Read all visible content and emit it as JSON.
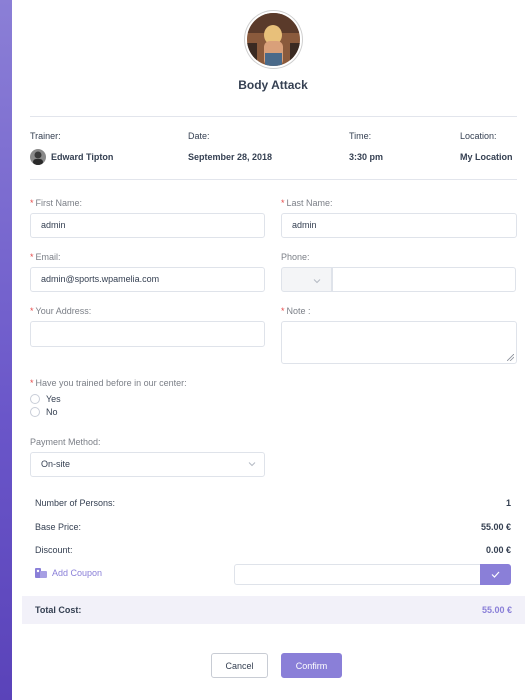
{
  "colors": {
    "accent": "#8a7fd8",
    "required": "#e64b4b",
    "text": "#354052",
    "muted": "#7b7f87"
  },
  "service": {
    "title": "Body Attack"
  },
  "info": {
    "trainer_label": "Trainer:",
    "trainer_value": "Edward Tipton",
    "date_label": "Date:",
    "date_value": "September 28, 2018",
    "time_label": "Time:",
    "time_value": "3:30 pm",
    "location_label": "Location:",
    "location_value": "My Location"
  },
  "form": {
    "required_mark": "*",
    "first_name_label": "First Name:",
    "first_name_value": "admin",
    "last_name_label": "Last Name:",
    "last_name_value": "admin",
    "email_label": "Email:",
    "email_value": "admin@sports.wpamelia.com",
    "phone_label": "Phone:",
    "phone_value": "",
    "address_label": "Your Address:",
    "address_value": "",
    "note_label": "Note :",
    "trained_question": "Have you trained before in our center:",
    "trained_options": [
      "Yes",
      "No"
    ],
    "payment_label": "Payment Method:",
    "payment_value": "On-site"
  },
  "summary": {
    "persons_label": "Number of Persons:",
    "persons_value": "1",
    "base_price_label": "Base Price:",
    "base_price_value": "55.00 €",
    "discount_label": "Discount:",
    "discount_value": "0.00 €",
    "coupon_link": "Add Coupon",
    "total_label": "Total Cost:",
    "total_value": "55.00 €"
  },
  "actions": {
    "cancel": "Cancel",
    "confirm": "Confirm"
  }
}
